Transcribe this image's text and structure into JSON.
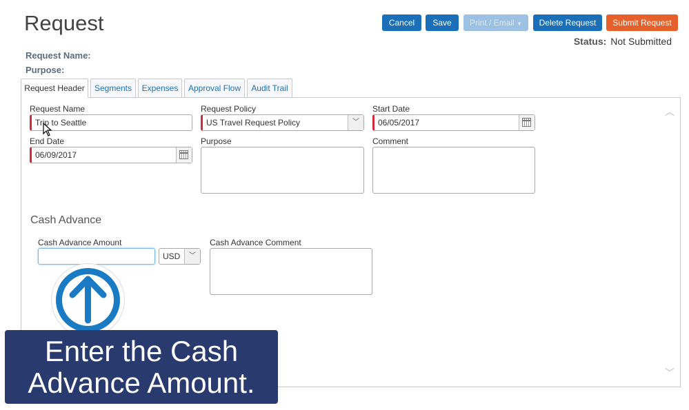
{
  "header": {
    "title": "Request",
    "buttons": {
      "cancel": "Cancel",
      "save": "Save",
      "print_email": "Print / Email",
      "delete": "Delete Request",
      "submit": "Submit Request"
    },
    "status_label": "Status:",
    "status_value": "Not Submitted",
    "request_name_label": "Request Name:",
    "purpose_label": "Purpose:"
  },
  "tabs": [
    "Request Header",
    "Segments",
    "Expenses",
    "Approval Flow",
    "Audit Trail"
  ],
  "form": {
    "request_name": {
      "label": "Request Name",
      "value": "Trip to Seattle"
    },
    "request_policy": {
      "label": "Request Policy",
      "value": "US Travel Request Policy"
    },
    "start_date": {
      "label": "Start Date",
      "value": "06/05/2017"
    },
    "end_date": {
      "label": "End Date",
      "value": "06/09/2017"
    },
    "purpose": {
      "label": "Purpose",
      "value": ""
    },
    "comment": {
      "label": "Comment",
      "value": ""
    }
  },
  "cash_advance": {
    "section_title": "Cash Advance",
    "amount_label": "Cash Advance Amount",
    "amount_value": "",
    "currency": "USD",
    "comment_label": "Cash Advance Comment",
    "comment_value": ""
  },
  "overlay": {
    "line1": "Enter the Cash",
    "line2": "Advance Amount."
  },
  "colors": {
    "primary_button": "#1a6fb8",
    "submit_button": "#e5602b",
    "required_marker": "#d2283a",
    "caption_bg": "#283a6e",
    "arrow_circle": "#1a7ac3"
  }
}
